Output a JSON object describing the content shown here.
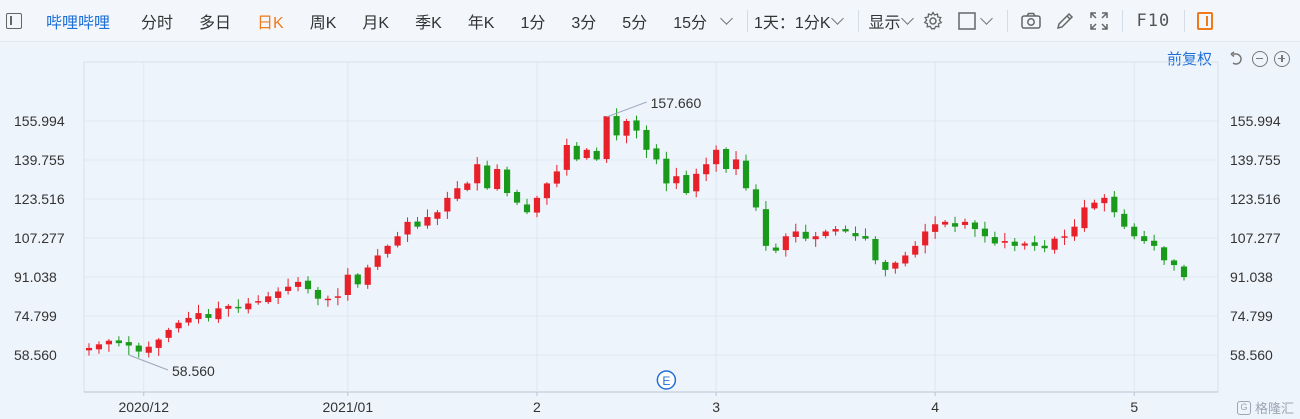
{
  "toolbar": {
    "stock_name": "哔哩哔哩",
    "periods": [
      "分时",
      "多日",
      "日K",
      "周K",
      "月K",
      "季K",
      "年K",
      "1分",
      "3分",
      "5分",
      "15分"
    ],
    "active_period": "日K",
    "interval_label": "1天：1分K",
    "display_label": "显示",
    "f10_label": "F10"
  },
  "adjust": {
    "label": "前复权"
  },
  "watermark": {
    "text": "格隆汇"
  },
  "colors": {
    "up": "#e8202a",
    "down": "#1a9a1a",
    "grid": "#dde7f2",
    "axis_text": "#333333",
    "accent": "#1e6fd9",
    "active": "#f07a1a"
  },
  "chart_data": {
    "type": "candlestick",
    "y_ticks": [
      58.56,
      74.799,
      91.038,
      107.277,
      123.516,
      139.755,
      155.994
    ],
    "y_tick_labels": [
      "58.560",
      "74.799",
      "91.038",
      "107.277",
      "123.516",
      "139.755",
      "155.994"
    ],
    "ylim": [
      46,
      175
    ],
    "x_labels": [
      {
        "label": "2020/12",
        "index": 5.5
      },
      {
        "label": "2021/01",
        "index": 26
      },
      {
        "label": "2",
        "index": 45
      },
      {
        "label": "3",
        "index": 63
      },
      {
        "label": "4",
        "index": 85
      },
      {
        "label": "5",
        "index": 105
      }
    ],
    "n_candles": 111,
    "annotations": {
      "max": {
        "label": "157.660",
        "index": 52,
        "value": 157.66
      },
      "min": {
        "label": "58.560",
        "index": 4,
        "value": 58.56
      },
      "event_marker": {
        "label": "E",
        "index": 58
      }
    },
    "closes": [
      61.5,
      63,
      64.5,
      63.5,
      62.5,
      60,
      62,
      65,
      69,
      72,
      74,
      76,
      74,
      78,
      79,
      78,
      80,
      81,
      83,
      85,
      87,
      89,
      86,
      82,
      82,
      83,
      92,
      88,
      95,
      100,
      104,
      108,
      114,
      112,
      116,
      118,
      124,
      128,
      130,
      138,
      128,
      136,
      126,
      122,
      118,
      124,
      130,
      135,
      146,
      140,
      144,
      140,
      158,
      150,
      156,
      152,
      144,
      140,
      130,
      133,
      126,
      134,
      138,
      144,
      136,
      140,
      128,
      120,
      104,
      102,
      108,
      110,
      107,
      108,
      110,
      111,
      110,
      108,
      107,
      98,
      94,
      97,
      100,
      104,
      110,
      113,
      114,
      112,
      114,
      111,
      108,
      105,
      106,
      104,
      105,
      104,
      103,
      107,
      108,
      112,
      120,
      122,
      124,
      118,
      112,
      108,
      106,
      104,
      98,
      96,
      91
    ]
  }
}
